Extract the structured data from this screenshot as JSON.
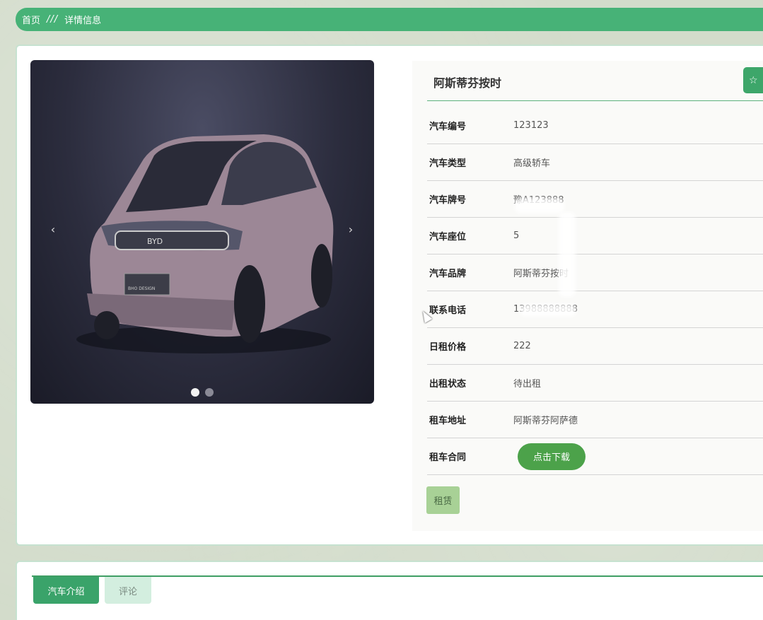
{
  "breadcrumb": {
    "home": "首页",
    "separator": "///",
    "current": "详情信息"
  },
  "carousel": {
    "prev": "‹",
    "next": "›",
    "slide_count": 2,
    "active_slide": 1,
    "badge_text": "BYD",
    "plate_text": "BHO DESIGN"
  },
  "info": {
    "title": "阿斯蒂芬按时",
    "favorite_icon": "☆",
    "rows": [
      {
        "label": "汽车编号",
        "value": "123123"
      },
      {
        "label": "汽车类型",
        "value": "高级轿车"
      },
      {
        "label": "汽车牌号",
        "value": "豫A123888"
      },
      {
        "label": "汽车座位",
        "value": "5"
      },
      {
        "label": "汽车品牌",
        "value": "阿斯蒂芬按时"
      },
      {
        "label": "联系电话",
        "value": "13988888888"
      },
      {
        "label": "日租价格",
        "value": "222"
      },
      {
        "label": "出租状态",
        "value": "待出租"
      },
      {
        "label": "租车地址",
        "value": "阿斯蒂芬阿萨德"
      }
    ],
    "contract": {
      "label": "租车合同",
      "button": "点击下载"
    },
    "rent_button": "租赁"
  },
  "tabs": {
    "intro": "汽车介绍",
    "comments": "评论"
  }
}
